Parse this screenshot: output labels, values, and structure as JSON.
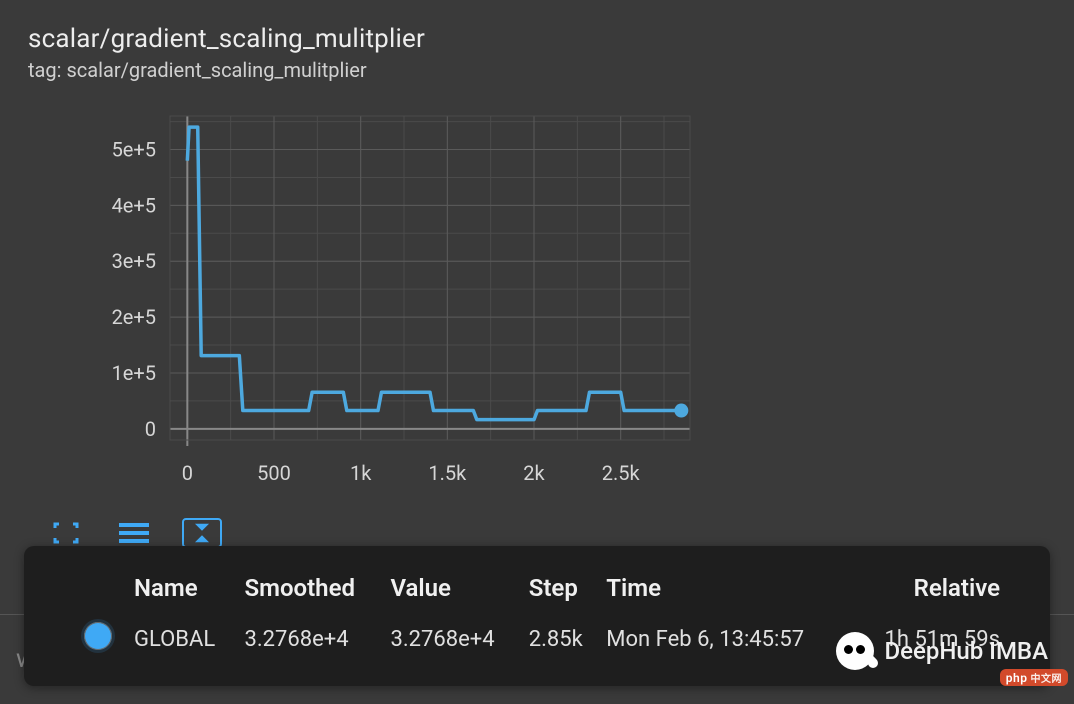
{
  "header": {
    "title": "scalar/gradient_scaling_mulitplier",
    "subtitle": "tag: scalar/gradient_scaling_mulitplier"
  },
  "chart_data": {
    "type": "line",
    "title": "",
    "xlabel": "",
    "ylabel": "",
    "xlim": [
      -100,
      2900
    ],
    "ylim": [
      -20000,
      560000
    ],
    "x_ticks": [
      0,
      500,
      1000,
      1500,
      2000,
      2500
    ],
    "x_tick_labels": [
      "0",
      "500",
      "1k",
      "1.5k",
      "2k",
      "2.5k"
    ],
    "y_ticks": [
      0,
      100000,
      200000,
      300000,
      400000,
      500000
    ],
    "y_tick_labels": [
      "0",
      "1e+5",
      "2e+5",
      "3e+5",
      "4e+5",
      "5e+5"
    ],
    "series": [
      {
        "name": "GLOBAL",
        "color": "#4da9df",
        "x": [
          0,
          10,
          60,
          80,
          300,
          320,
          700,
          720,
          900,
          920,
          1100,
          1120,
          1400,
          1420,
          1650,
          1670,
          2000,
          2020,
          2300,
          2320,
          2500,
          2520,
          2650,
          2670,
          2850
        ],
        "values": [
          480000,
          540000,
          540000,
          131072,
          131072,
          32768,
          32768,
          65536,
          65536,
          32768,
          32768,
          65536,
          65536,
          32768,
          32768,
          16384,
          16384,
          32768,
          32768,
          65536,
          65536,
          32768,
          32768,
          32768,
          32768
        ]
      }
    ],
    "highlight": {
      "x": 2850,
      "y": 32768
    }
  },
  "tooltip": {
    "columns": [
      "Name",
      "Smoothed",
      "Value",
      "Step",
      "Time",
      "Relative"
    ],
    "rows": [
      {
        "name": "GLOBAL",
        "smoothed": "3.2768e+4",
        "value": "3.2768e+4",
        "step": "2.85k",
        "time": "Mon Feb 6, 13:45:57",
        "relative": "1h 51m 59s"
      }
    ]
  },
  "toolbar": {
    "expand_label": "expand",
    "list_label": "list",
    "fit_label": "fit-domain"
  },
  "background_text": "weights",
  "watermark_text": "DeepHub IMBA",
  "badge": {
    "text": "php",
    "cn": "中文网"
  }
}
